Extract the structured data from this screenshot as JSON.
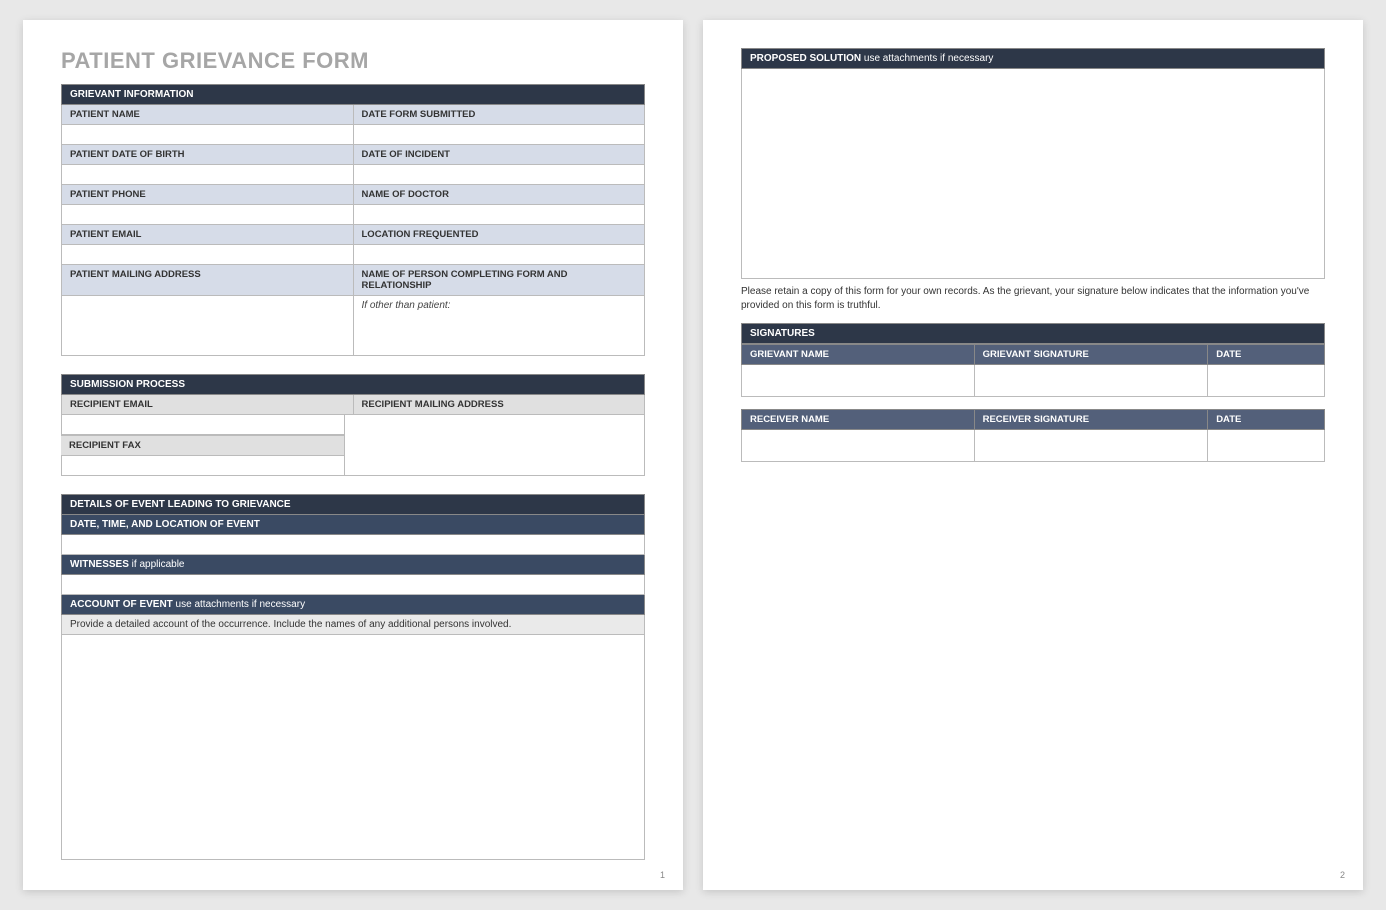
{
  "title": "PATIENT GRIEVANCE FORM",
  "page1_num": "1",
  "page2_num": "2",
  "grievant_info": {
    "header": "GRIEVANT INFORMATION",
    "patient_name": "PATIENT NAME",
    "date_submitted": "DATE FORM SUBMITTED",
    "dob": "PATIENT DATE OF BIRTH",
    "date_incident": "DATE OF INCIDENT",
    "phone": "PATIENT PHONE",
    "doctor": "NAME OF DOCTOR",
    "email": "PATIENT EMAIL",
    "location": "LOCATION FREQUENTED",
    "mailing": "PATIENT MAILING ADDRESS",
    "completer": "NAME OF PERSON COMPLETING FORM AND RELATIONSHIP",
    "completer_hint": "If other than patient:"
  },
  "submission": {
    "header": "SUBMISSION PROCESS",
    "email": "RECIPIENT EMAIL",
    "mailing": "RECIPIENT MAILING ADDRESS",
    "fax": "RECIPIENT FAX"
  },
  "details": {
    "header": "DETAILS OF EVENT LEADING TO GRIEVANCE",
    "datetime": "DATE, TIME, AND LOCATION OF EVENT",
    "witnesses": "WITNESSES",
    "witnesses_sub": " if applicable",
    "account": "ACCOUNT OF EVENT",
    "account_sub": "  use attachments if necessary",
    "account_hint": "Provide a detailed account of the occurrence.  Include the names of any additional persons involved."
  },
  "proposed": {
    "header": "PROPOSED SOLUTION",
    "sub": "  use attachments if necessary"
  },
  "note": "Please retain a copy of this form for your own records.  As the grievant, your signature below indicates that the information you've provided on this form is truthful.",
  "signatures": {
    "header": "SIGNATURES",
    "grievant_name": "GRIEVANT NAME",
    "grievant_sig": "GRIEVANT SIGNATURE",
    "date": "DATE",
    "receiver_name": "RECEIVER NAME",
    "receiver_sig": "RECEIVER SIGNATURE"
  }
}
